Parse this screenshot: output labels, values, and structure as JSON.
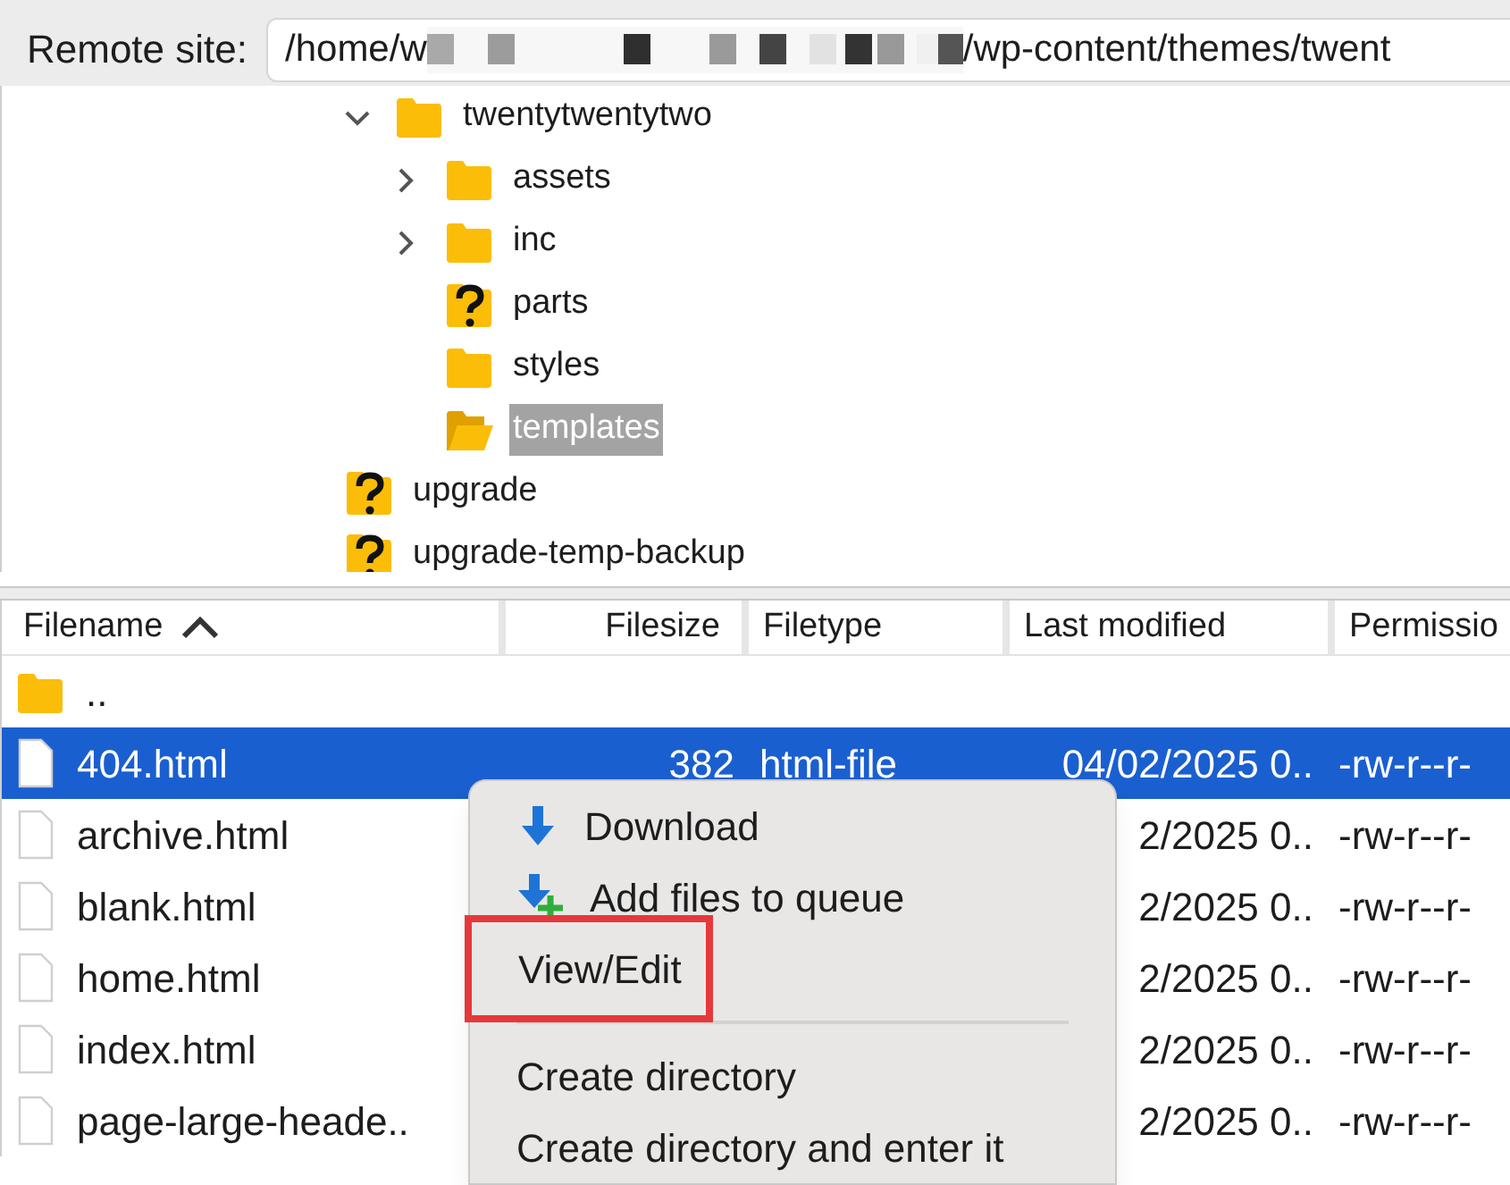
{
  "remote_site": {
    "label": "Remote site:",
    "path_start": "/home/w",
    "path_end": "/wp-content/themes/twent",
    "redacted": true
  },
  "tree": {
    "items": [
      {
        "children": [
          {
            "label": "twentytwentytwo",
            "kind": "folder",
            "expanded": true,
            "selected": false,
            "children": [
              {
                "label": "assets",
                "kind": "folder",
                "expanded": false,
                "selected": false
              },
              {
                "label": "inc",
                "kind": "folder",
                "expanded": false,
                "selected": false
              },
              {
                "label": "parts",
                "kind": "unknown",
                "selected": false
              },
              {
                "label": "styles",
                "kind": "folder",
                "selected": false
              },
              {
                "label": "templates",
                "kind": "open-folder",
                "selected": true
              }
            ]
          }
        ]
      },
      {
        "label": "upgrade",
        "kind": "unknown",
        "selected": false
      },
      {
        "label": "upgrade-temp-backup",
        "kind": "unknown",
        "selected": false
      }
    ]
  },
  "file_list": {
    "columns": [
      {
        "label": "Filename",
        "sorted": true
      },
      {
        "label": "Filesize",
        "sorted": false
      },
      {
        "label": "Filetype",
        "sorted": false
      },
      {
        "label": "Last modified",
        "sorted": false
      },
      {
        "label": "Permissio"
      }
    ],
    "rows": [
      {
        "kind": "folder",
        "filename": "..",
        "selected": false
      },
      {
        "kind": "file",
        "filename": "404.html",
        "filesize": "382",
        "filetype": "html-file",
        "last_modified": "04/02/2025 0..",
        "permissions": "-rw-r--r-",
        "selected": true
      },
      {
        "kind": "file",
        "filename": "archive.html",
        "last_modified": "2/2025 0..",
        "permissions": "-rw-r--r-",
        "selected": false
      },
      {
        "kind": "file",
        "filename": "blank.html",
        "last_modified": "2/2025 0..",
        "permissions": "-rw-r--r-",
        "selected": false
      },
      {
        "kind": "file",
        "filename": "home.html",
        "last_modified": "2/2025 0..",
        "permissions": "-rw-r--r-",
        "selected": false
      },
      {
        "kind": "file",
        "filename": "index.html",
        "last_modified": "2/2025 0..",
        "permissions": "-rw-r--r-",
        "selected": false
      },
      {
        "kind": "file",
        "filename": "page-large-heade..",
        "last_modified": "2/2025 0..",
        "permissions": "-rw-r--r-",
        "selected": false
      }
    ]
  },
  "context_menu": {
    "items": [
      {
        "kind": "download",
        "label": "Download",
        "highlighted": false
      },
      {
        "kind": "add-queue",
        "label": "Add files to queue",
        "highlighted": false
      },
      {
        "kind": "item",
        "label": "View/Edit",
        "highlighted": true
      },
      {
        "kind": "separator"
      },
      {
        "kind": "item",
        "label": "Create directory",
        "highlighted": false
      },
      {
        "kind": "item",
        "label": "Create directory and enter it",
        "highlighted": false
      }
    ]
  }
}
